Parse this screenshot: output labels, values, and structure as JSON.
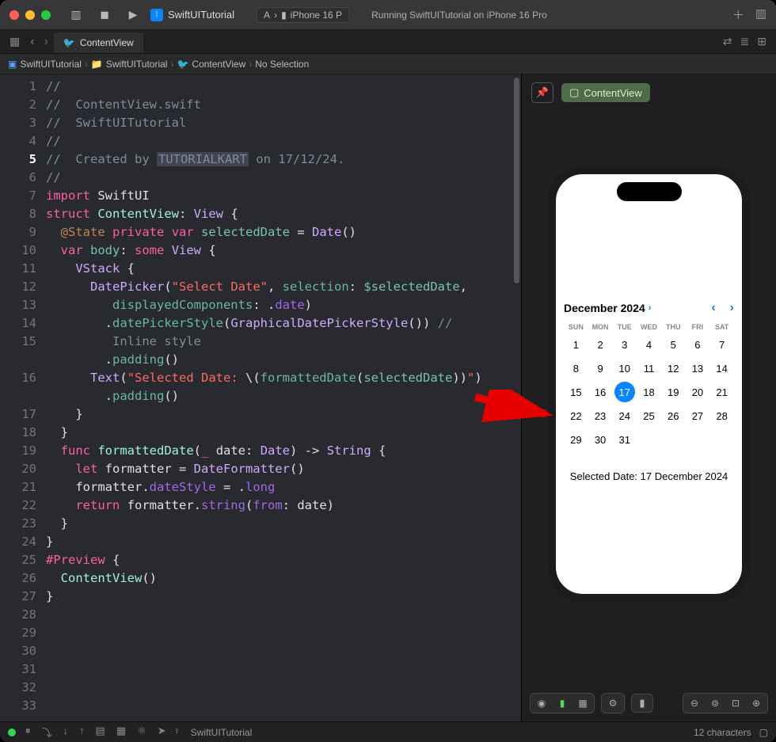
{
  "titlebar": {
    "project": "SwiftUITutorial",
    "scheme_app": "A",
    "scheme_device": "iPhone 16 P",
    "status": "Running SwiftUITutorial on iPhone 16 Pro"
  },
  "tab": {
    "name": "ContentView"
  },
  "crumbs": {
    "root": "SwiftUITutorial",
    "folder": "SwiftUITutorial",
    "file": "ContentView",
    "selection": "No Selection"
  },
  "code": {
    "lines": [
      {
        "n": 1,
        "seg": [
          [
            "//",
            "c-comment"
          ]
        ]
      },
      {
        "n": 2,
        "seg": [
          [
            "//  ContentView.swift",
            "c-comment"
          ]
        ]
      },
      {
        "n": 3,
        "seg": [
          [
            "//  SwiftUITutorial",
            "c-comment"
          ]
        ]
      },
      {
        "n": 4,
        "seg": [
          [
            "//",
            "c-comment"
          ]
        ]
      },
      {
        "n": 5,
        "cur": true,
        "seg": [
          [
            "//  Created by ",
            "c-comment"
          ],
          [
            "TUTORIALKART",
            "c-comment hl"
          ],
          [
            " on 17/12/24.",
            "c-comment"
          ]
        ]
      },
      {
        "n": 6,
        "seg": [
          [
            "//",
            "c-comment"
          ]
        ]
      },
      {
        "n": 7,
        "seg": [
          [
            "",
            ""
          ]
        ]
      },
      {
        "n": 8,
        "seg": [
          [
            "import",
            "c-keyword"
          ],
          [
            " SwiftUI",
            ""
          ]
        ]
      },
      {
        "n": 9,
        "seg": [
          [
            "",
            ""
          ]
        ]
      },
      {
        "n": 10,
        "seg": [
          [
            "struct",
            "c-keyword"
          ],
          [
            " ",
            ""
          ],
          [
            "ContentView",
            "c-type"
          ],
          [
            ": ",
            ""
          ],
          [
            "View",
            "c-typep"
          ],
          [
            " {",
            ""
          ]
        ]
      },
      {
        "n": 11,
        "seg": [
          [
            "  ",
            ""
          ],
          [
            "@State",
            "c-attr"
          ],
          [
            " ",
            ""
          ],
          [
            "private",
            "c-keyword"
          ],
          [
            " ",
            ""
          ],
          [
            "var",
            "c-keyword"
          ],
          [
            " ",
            ""
          ],
          [
            "selectedDate",
            "c-prop"
          ],
          [
            " = ",
            ""
          ],
          [
            "Date",
            "c-typep"
          ],
          [
            "()",
            ""
          ]
        ]
      },
      {
        "n": 12,
        "seg": [
          [
            "",
            ""
          ]
        ]
      },
      {
        "n": 13,
        "seg": [
          [
            "  ",
            ""
          ],
          [
            "var",
            "c-keyword"
          ],
          [
            " ",
            ""
          ],
          [
            "body",
            "c-prop"
          ],
          [
            ": ",
            ""
          ],
          [
            "some",
            "c-keyword"
          ],
          [
            " ",
            ""
          ],
          [
            "View",
            "c-typep"
          ],
          [
            " {",
            ""
          ]
        ]
      },
      {
        "n": 14,
        "seg": [
          [
            "    ",
            ""
          ],
          [
            "VStack",
            "c-typep"
          ],
          [
            " {",
            ""
          ]
        ]
      },
      {
        "n": 15,
        "seg": [
          [
            "      ",
            ""
          ],
          [
            "DatePicker",
            "c-typep"
          ],
          [
            "(",
            ""
          ],
          [
            "\"Select Date\"",
            "c-string"
          ],
          [
            ", ",
            ""
          ],
          [
            "selection",
            "c-func"
          ],
          [
            ": ",
            ""
          ],
          [
            "$selectedDate",
            "c-prop"
          ],
          [
            ",\n         ",
            ""
          ],
          [
            "displayedComponents",
            "c-func"
          ],
          [
            ": .",
            ""
          ],
          [
            "date",
            "c-funcp"
          ],
          [
            ")",
            ""
          ]
        ]
      },
      {
        "n": 16,
        "seg": [
          [
            "        .",
            ""
          ],
          [
            "datePickerStyle",
            "c-func"
          ],
          [
            "(",
            ""
          ],
          [
            "GraphicalDatePickerStyle",
            "c-typep"
          ],
          [
            "()) ",
            ""
          ],
          [
            "//\n         Inline style",
            "c-comment"
          ]
        ]
      },
      {
        "n": 17,
        "seg": [
          [
            "        .",
            ""
          ],
          [
            "padding",
            "c-func"
          ],
          [
            "()",
            ""
          ]
        ]
      },
      {
        "n": 18,
        "seg": [
          [
            "",
            ""
          ]
        ]
      },
      {
        "n": 19,
        "seg": [
          [
            "      ",
            ""
          ],
          [
            "Text",
            "c-typep"
          ],
          [
            "(",
            ""
          ],
          [
            "\"Selected Date: ",
            "c-string"
          ],
          [
            "\\(",
            ""
          ],
          [
            "formattedDate",
            "c-func"
          ],
          [
            "(",
            ""
          ],
          [
            "selectedDate",
            "c-prop"
          ],
          [
            ")",
            ""
          ],
          [
            ")",
            ""
          ],
          [
            "\"",
            "c-string"
          ],
          [
            ")",
            ""
          ]
        ]
      },
      {
        "n": 20,
        "seg": [
          [
            "        .",
            ""
          ],
          [
            "padding",
            "c-func"
          ],
          [
            "()",
            ""
          ]
        ]
      },
      {
        "n": 21,
        "seg": [
          [
            "    }",
            ""
          ]
        ]
      },
      {
        "n": 22,
        "seg": [
          [
            "  }",
            ""
          ]
        ]
      },
      {
        "n": 23,
        "seg": [
          [
            "",
            ""
          ]
        ]
      },
      {
        "n": 24,
        "seg": [
          [
            "  ",
            ""
          ],
          [
            "func",
            "c-keyword"
          ],
          [
            " ",
            ""
          ],
          [
            "formattedDate",
            "c-type"
          ],
          [
            "(",
            ""
          ],
          [
            "_",
            "c-keyword"
          ],
          [
            " date: ",
            ""
          ],
          [
            "Date",
            "c-typep"
          ],
          [
            ") -> ",
            ""
          ],
          [
            "String",
            "c-typep"
          ],
          [
            " {",
            ""
          ]
        ]
      },
      {
        "n": 25,
        "seg": [
          [
            "    ",
            ""
          ],
          [
            "let",
            "c-keyword"
          ],
          [
            " formatter = ",
            ""
          ],
          [
            "DateFormatter",
            "c-typep"
          ],
          [
            "()",
            ""
          ]
        ]
      },
      {
        "n": 26,
        "seg": [
          [
            "    formatter.",
            ""
          ],
          [
            "dateStyle",
            "c-funcp"
          ],
          [
            " = .",
            ""
          ],
          [
            "long",
            "c-funcp"
          ]
        ]
      },
      {
        "n": 27,
        "seg": [
          [
            "    ",
            ""
          ],
          [
            "return",
            "c-keyword"
          ],
          [
            " formatter.",
            ""
          ],
          [
            "string",
            "c-funcp"
          ],
          [
            "(",
            ""
          ],
          [
            "from",
            "c-funcp"
          ],
          [
            ": date)",
            ""
          ]
        ]
      },
      {
        "n": 28,
        "seg": [
          [
            "  }",
            ""
          ]
        ]
      },
      {
        "n": 29,
        "seg": [
          [
            "}",
            ""
          ]
        ]
      },
      {
        "n": 30,
        "seg": [
          [
            "",
            ""
          ]
        ]
      },
      {
        "n": 31,
        "seg": [
          [
            "#Preview",
            "c-keyword"
          ],
          [
            " {",
            ""
          ]
        ]
      },
      {
        "n": 32,
        "seg": [
          [
            "  ",
            ""
          ],
          [
            "ContentView",
            "c-type"
          ],
          [
            "()",
            ""
          ]
        ]
      },
      {
        "n": 33,
        "seg": [
          [
            "}",
            ""
          ]
        ]
      }
    ]
  },
  "preview": {
    "chip": "ContentView",
    "month": "December 2024",
    "dow": [
      "SUN",
      "MON",
      "TUE",
      "WED",
      "THU",
      "FRI",
      "SAT"
    ],
    "weeks": [
      [
        1,
        2,
        3,
        4,
        5,
        6,
        7
      ],
      [
        8,
        9,
        10,
        11,
        12,
        13,
        14
      ],
      [
        15,
        16,
        17,
        18,
        19,
        20,
        21
      ],
      [
        22,
        23,
        24,
        25,
        26,
        27,
        28
      ],
      [
        29,
        30,
        31,
        "",
        "",
        "",
        ""
      ]
    ],
    "selected_day": 17,
    "selected_text": "Selected Date: 17 December 2024"
  },
  "statusbar": {
    "project": "SwiftUITutorial",
    "chars": "12 characters"
  }
}
